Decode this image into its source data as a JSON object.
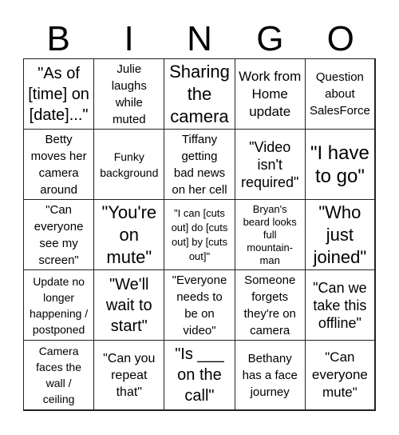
{
  "header": {
    "letters": [
      "B",
      "I",
      "N",
      "G",
      "O"
    ]
  },
  "cells": [
    "\"As of\n[time] on\n[date]...\"",
    "Julie\nlaughs\nwhile\nmuted",
    "Sharing\nthe\ncamera",
    "Work from\nHome\nupdate",
    "Question\nabout\nSalesForce",
    "Betty\nmoves her\ncamera\naround",
    "Funky\nbackground",
    "Tiffany\ngetting\nbad news\non her cell",
    "\"Video\nisn't\nrequired\"",
    "\"I have\nto go\"",
    "\"Can\neveryone\nsee my\nscreen\"",
    "\"You're\non\nmute\"",
    "\"I can [cuts\nout] do [cuts\nout] by [cuts\nout]\"",
    "Bryan's\nbeard looks\nfull\nmountain-\nman",
    "\"Who\njust\njoined\"",
    "Update no\nlonger\nhappening /\npostponed",
    "\"We'll\nwait to\nstart\"",
    "\"Everyone\nneeds to\nbe on\nvideo\"",
    "Someone\nforgets\nthey're on\ncamera",
    "\"Can we\ntake this\noffline\"",
    "Camera\nfaces the\nwall /\nceiling",
    "\"Can you\nrepeat\nthat\"",
    "\"Is ___\non the\ncall\"",
    "Bethany\nhas a face\njourney",
    "\"Can\neveryone\nmute\""
  ]
}
